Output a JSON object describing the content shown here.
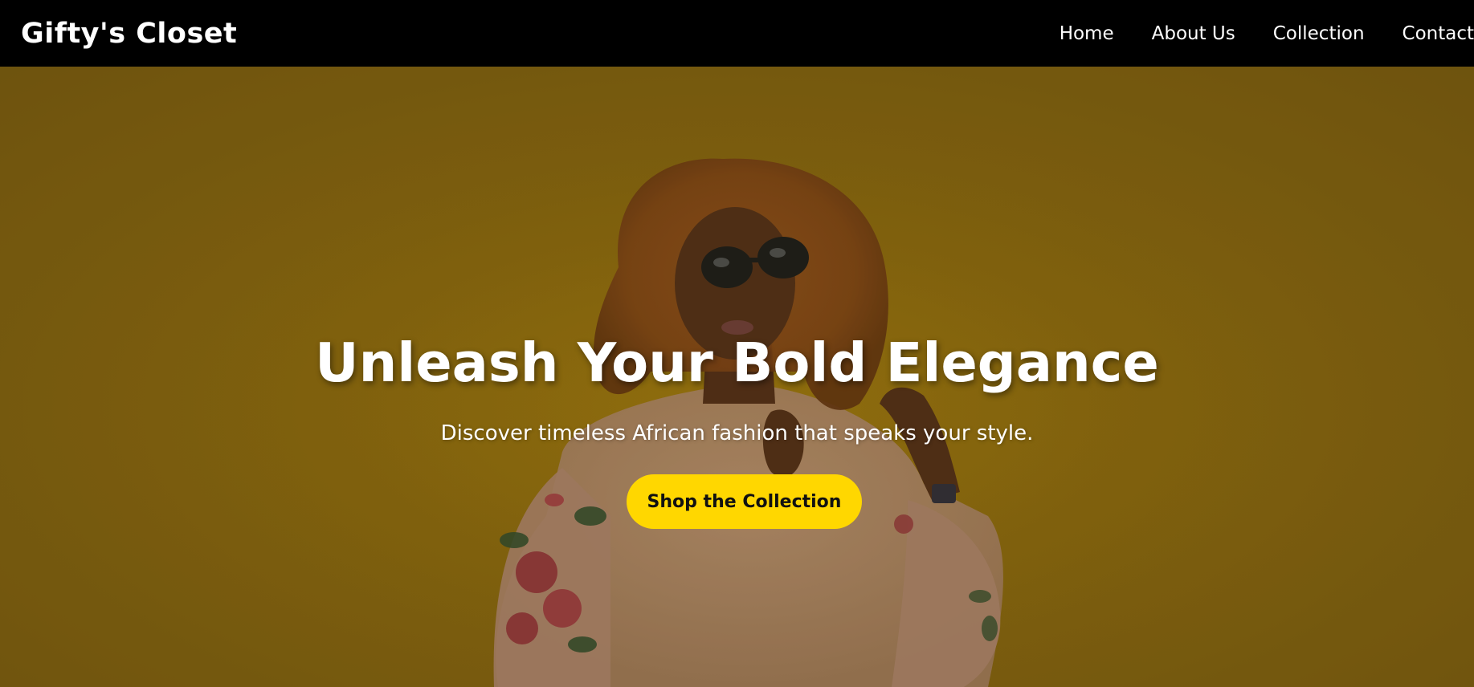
{
  "header": {
    "logo_text": "Gifty's Closet",
    "nav": [
      {
        "label": "Home"
      },
      {
        "label": "About Us"
      },
      {
        "label": "Collection"
      },
      {
        "label": "Contact"
      }
    ]
  },
  "hero": {
    "title": "Unleash Your Bold Elegance",
    "subtitle": "Discover timeless African fashion that speaks your style.",
    "cta_label": "Shop the Collection",
    "background_image": "woman-in-sunglasses-and-floral-sweater-photo"
  },
  "colors": {
    "header_bg": "#000000",
    "hero_overlay": "#86650f",
    "cta_bg": "#ffd700",
    "text": "#ffffff"
  }
}
